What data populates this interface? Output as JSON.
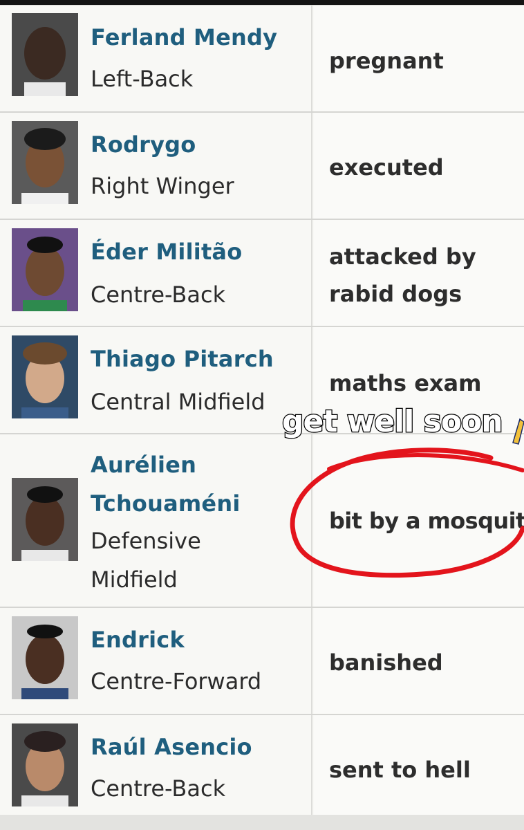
{
  "overlay": {
    "caption": "get well soon",
    "emoji_icon": "praying-hands-icon",
    "circle_color": "#e3141c"
  },
  "players": [
    {
      "name": "Ferland Mendy",
      "position": "Left-Back",
      "status": "pregnant"
    },
    {
      "name": "Rodrygo",
      "position": "Right Winger",
      "status": "executed"
    },
    {
      "name": "Éder Militão",
      "position": "Centre-Back",
      "status_lines": [
        "attacked by",
        "rabid dogs"
      ]
    },
    {
      "name": "Thiago Pitarch",
      "position": "Central Midfield",
      "status": "maths exam"
    },
    {
      "name_lines": [
        "Aurélien",
        "Tchouaméni"
      ],
      "position_lines": [
        "Defensive",
        "Midfield"
      ],
      "status": "bit by a mosquito"
    },
    {
      "name": "Endrick",
      "position": "Centre-Forward",
      "status": "banished"
    },
    {
      "name": "Raúl Asencio",
      "position": "Centre-Back",
      "status": "sent to hell"
    }
  ],
  "colors": {
    "name": "#1f5e7e",
    "text": "#2d2d2d",
    "border": "#d5d5d2"
  }
}
